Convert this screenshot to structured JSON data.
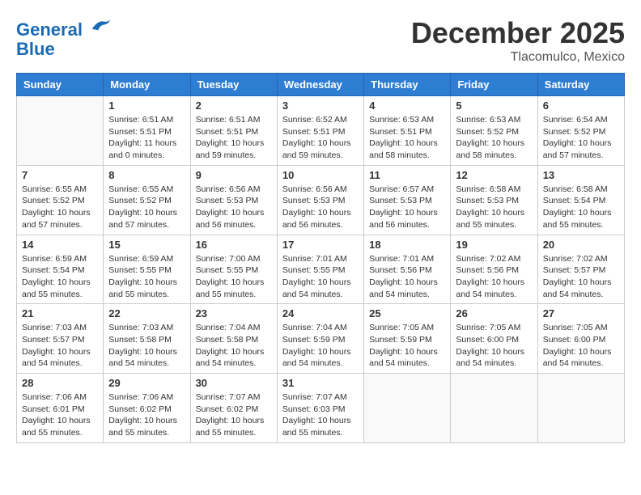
{
  "header": {
    "logo_line1": "General",
    "logo_line2": "Blue",
    "month": "December 2025",
    "location": "Tlacomulco, Mexico"
  },
  "weekdays": [
    "Sunday",
    "Monday",
    "Tuesday",
    "Wednesday",
    "Thursday",
    "Friday",
    "Saturday"
  ],
  "weeks": [
    [
      {
        "day": "",
        "sunrise": "",
        "sunset": "",
        "daylight": ""
      },
      {
        "day": "1",
        "sunrise": "6:51 AM",
        "sunset": "5:51 PM",
        "daylight": "11 hours and 0 minutes."
      },
      {
        "day": "2",
        "sunrise": "6:51 AM",
        "sunset": "5:51 PM",
        "daylight": "10 hours and 59 minutes."
      },
      {
        "day": "3",
        "sunrise": "6:52 AM",
        "sunset": "5:51 PM",
        "daylight": "10 hours and 59 minutes."
      },
      {
        "day": "4",
        "sunrise": "6:53 AM",
        "sunset": "5:51 PM",
        "daylight": "10 hours and 58 minutes."
      },
      {
        "day": "5",
        "sunrise": "6:53 AM",
        "sunset": "5:52 PM",
        "daylight": "10 hours and 58 minutes."
      },
      {
        "day": "6",
        "sunrise": "6:54 AM",
        "sunset": "5:52 PM",
        "daylight": "10 hours and 57 minutes."
      }
    ],
    [
      {
        "day": "7",
        "sunrise": "6:55 AM",
        "sunset": "5:52 PM",
        "daylight": "10 hours and 57 minutes."
      },
      {
        "day": "8",
        "sunrise": "6:55 AM",
        "sunset": "5:52 PM",
        "daylight": "10 hours and 57 minutes."
      },
      {
        "day": "9",
        "sunrise": "6:56 AM",
        "sunset": "5:53 PM",
        "daylight": "10 hours and 56 minutes."
      },
      {
        "day": "10",
        "sunrise": "6:56 AM",
        "sunset": "5:53 PM",
        "daylight": "10 hours and 56 minutes."
      },
      {
        "day": "11",
        "sunrise": "6:57 AM",
        "sunset": "5:53 PM",
        "daylight": "10 hours and 56 minutes."
      },
      {
        "day": "12",
        "sunrise": "6:58 AM",
        "sunset": "5:53 PM",
        "daylight": "10 hours and 55 minutes."
      },
      {
        "day": "13",
        "sunrise": "6:58 AM",
        "sunset": "5:54 PM",
        "daylight": "10 hours and 55 minutes."
      }
    ],
    [
      {
        "day": "14",
        "sunrise": "6:59 AM",
        "sunset": "5:54 PM",
        "daylight": "10 hours and 55 minutes."
      },
      {
        "day": "15",
        "sunrise": "6:59 AM",
        "sunset": "5:55 PM",
        "daylight": "10 hours and 55 minutes."
      },
      {
        "day": "16",
        "sunrise": "7:00 AM",
        "sunset": "5:55 PM",
        "daylight": "10 hours and 55 minutes."
      },
      {
        "day": "17",
        "sunrise": "7:01 AM",
        "sunset": "5:55 PM",
        "daylight": "10 hours and 54 minutes."
      },
      {
        "day": "18",
        "sunrise": "7:01 AM",
        "sunset": "5:56 PM",
        "daylight": "10 hours and 54 minutes."
      },
      {
        "day": "19",
        "sunrise": "7:02 AM",
        "sunset": "5:56 PM",
        "daylight": "10 hours and 54 minutes."
      },
      {
        "day": "20",
        "sunrise": "7:02 AM",
        "sunset": "5:57 PM",
        "daylight": "10 hours and 54 minutes."
      }
    ],
    [
      {
        "day": "21",
        "sunrise": "7:03 AM",
        "sunset": "5:57 PM",
        "daylight": "10 hours and 54 minutes."
      },
      {
        "day": "22",
        "sunrise": "7:03 AM",
        "sunset": "5:58 PM",
        "daylight": "10 hours and 54 minutes."
      },
      {
        "day": "23",
        "sunrise": "7:04 AM",
        "sunset": "5:58 PM",
        "daylight": "10 hours and 54 minutes."
      },
      {
        "day": "24",
        "sunrise": "7:04 AM",
        "sunset": "5:59 PM",
        "daylight": "10 hours and 54 minutes."
      },
      {
        "day": "25",
        "sunrise": "7:05 AM",
        "sunset": "5:59 PM",
        "daylight": "10 hours and 54 minutes."
      },
      {
        "day": "26",
        "sunrise": "7:05 AM",
        "sunset": "6:00 PM",
        "daylight": "10 hours and 54 minutes."
      },
      {
        "day": "27",
        "sunrise": "7:05 AM",
        "sunset": "6:00 PM",
        "daylight": "10 hours and 54 minutes."
      }
    ],
    [
      {
        "day": "28",
        "sunrise": "7:06 AM",
        "sunset": "6:01 PM",
        "daylight": "10 hours and 55 minutes."
      },
      {
        "day": "29",
        "sunrise": "7:06 AM",
        "sunset": "6:02 PM",
        "daylight": "10 hours and 55 minutes."
      },
      {
        "day": "30",
        "sunrise": "7:07 AM",
        "sunset": "6:02 PM",
        "daylight": "10 hours and 55 minutes."
      },
      {
        "day": "31",
        "sunrise": "7:07 AM",
        "sunset": "6:03 PM",
        "daylight": "10 hours and 55 minutes."
      },
      {
        "day": "",
        "sunrise": "",
        "sunset": "",
        "daylight": ""
      },
      {
        "day": "",
        "sunrise": "",
        "sunset": "",
        "daylight": ""
      },
      {
        "day": "",
        "sunrise": "",
        "sunset": "",
        "daylight": ""
      }
    ]
  ]
}
